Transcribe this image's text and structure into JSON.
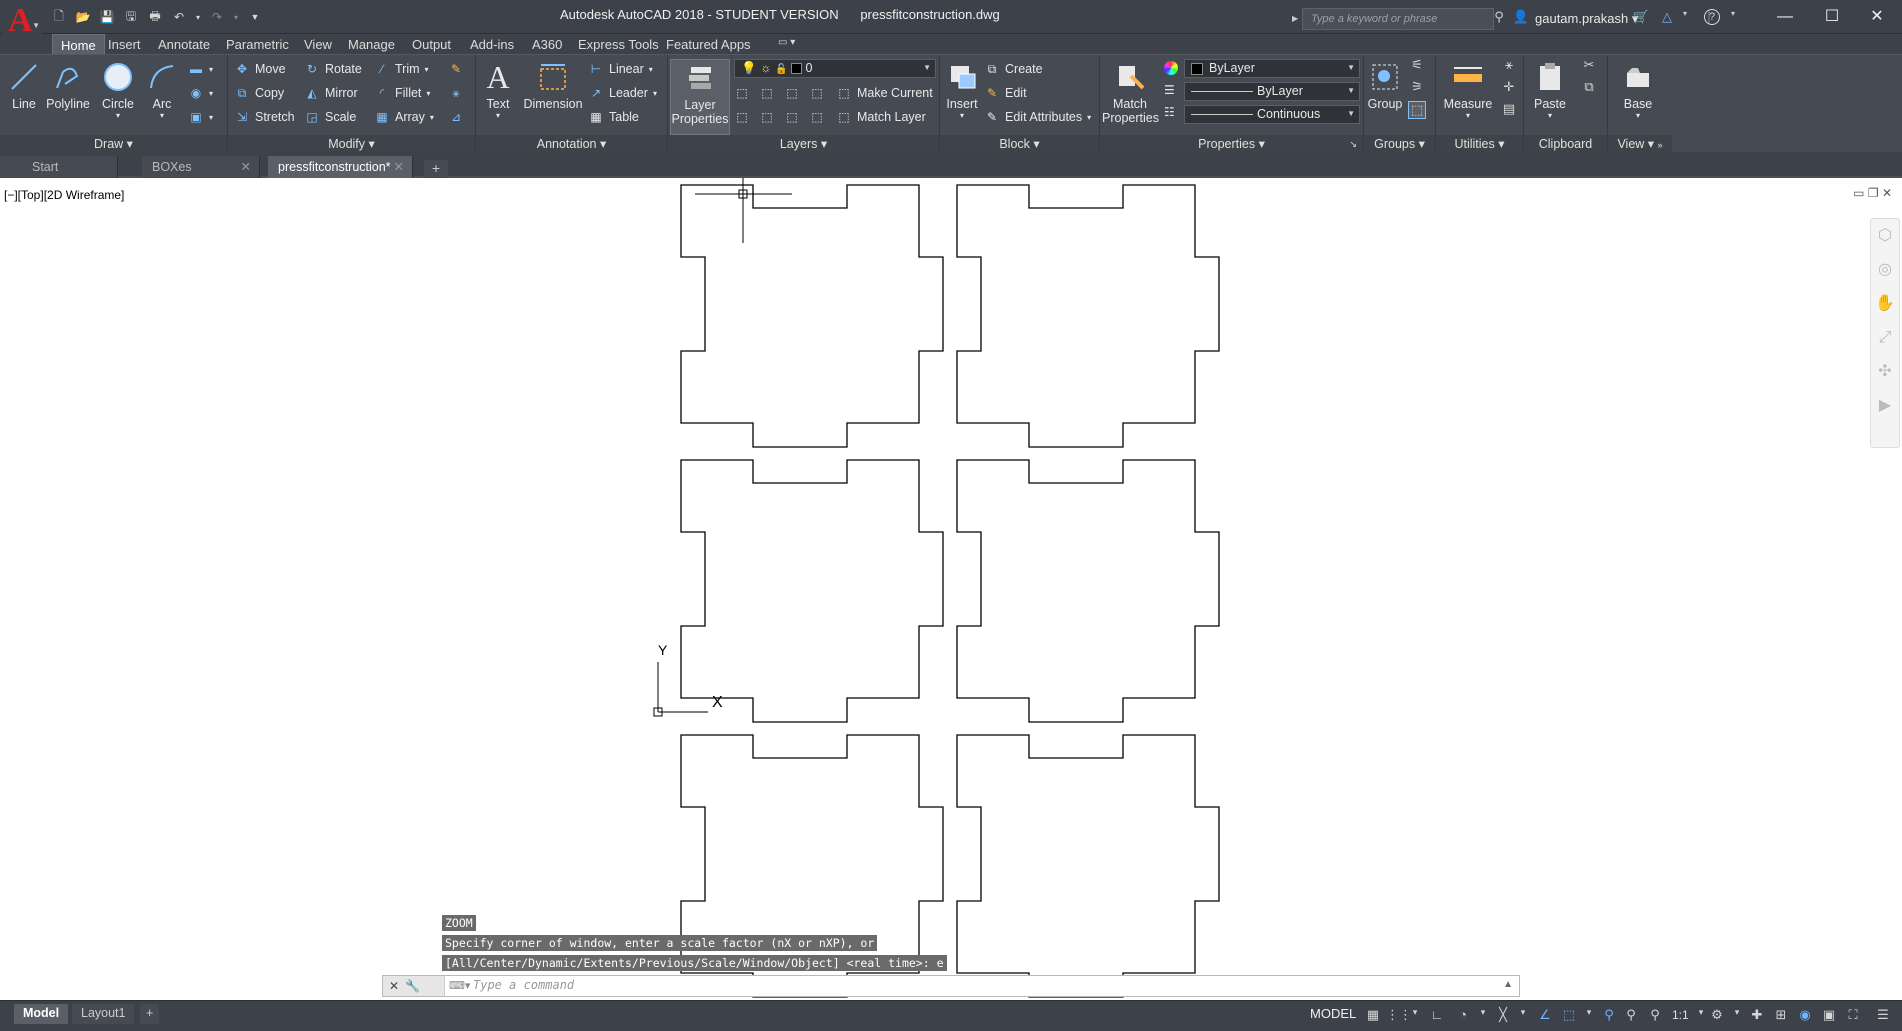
{
  "titlebar": {
    "title": "Autodesk AutoCAD 2018 - STUDENT VERSION      pressfitconstruction.dwg",
    "search_placeholder": "Type a keyword or phrase",
    "user": "gautam.prakash",
    "minimize": "—",
    "maximize": "☐",
    "close": "✕"
  },
  "menu": {
    "tabs": [
      "Home",
      "Insert",
      "Annotate",
      "Parametric",
      "View",
      "Manage",
      "Output",
      "Add-ins",
      "A360",
      "Express Tools",
      "Featured Apps"
    ]
  },
  "ribbon": {
    "draw": {
      "title": "Draw",
      "line": "Line",
      "polyline": "Polyline",
      "circle": "Circle",
      "arc": "Arc"
    },
    "modify": {
      "title": "Modify",
      "move": "Move",
      "rotate": "Rotate",
      "trim": "Trim",
      "copy": "Copy",
      "mirror": "Mirror",
      "fillet": "Fillet",
      "stretch": "Stretch",
      "scale": "Scale",
      "array": "Array"
    },
    "annotation": {
      "title": "Annotation",
      "text": "Text",
      "dimension": "Dimension",
      "linear": "Linear",
      "leader": "Leader",
      "table": "Table"
    },
    "layers": {
      "title": "Layers",
      "layer_properties": "Layer Properties",
      "layer_value": "0",
      "make_current": "Make Current",
      "match_layer": "Match Layer"
    },
    "block": {
      "title": "Block",
      "insert": "Insert",
      "create": "Create",
      "edit": "Edit",
      "edit_attributes": "Edit Attributes"
    },
    "properties": {
      "title": "Properties",
      "match_properties": "Match Properties",
      "color": "ByLayer",
      "lineweight": "ByLayer",
      "linetype": "Continuous"
    },
    "groups": {
      "title": "Groups",
      "group": "Group"
    },
    "utilities": {
      "title": "Utilities",
      "measure": "Measure"
    },
    "clipboard": {
      "title": "Clipboard",
      "paste": "Paste"
    },
    "view": {
      "title": "View",
      "base": "Base"
    }
  },
  "filetabs": {
    "tabs": [
      {
        "label": "Start"
      },
      {
        "label": "BOXes"
      },
      {
        "label": "pressfitconstruction*"
      }
    ]
  },
  "viewport": {
    "label": "[−][Top][2D Wireframe]",
    "y_axis": "Y",
    "x_axis": "X"
  },
  "command": {
    "history": [
      "ZOOM",
      "Specify corner of window, enter a scale factor (nX or nXP), or",
      "[All/Center/Dynamic/Extents/Previous/Scale/Window/Object] <real time>: e"
    ],
    "placeholder": "Type a command"
  },
  "status": {
    "layout_tabs": [
      "Model",
      "Layout1"
    ],
    "model": "MODEL",
    "scale": "1:1"
  }
}
